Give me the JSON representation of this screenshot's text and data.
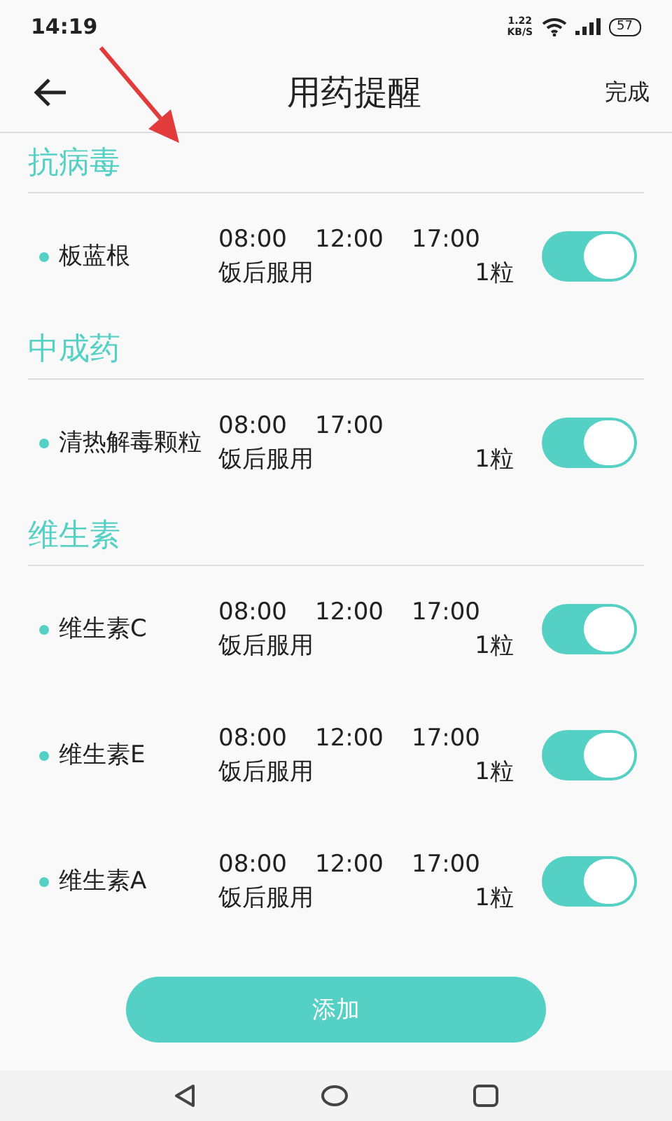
{
  "status_bar": {
    "time": "14:19",
    "speed": "1.22",
    "speed_unit": "KB/S",
    "battery": "57"
  },
  "header": {
    "title": "用药提醒",
    "action": "完成"
  },
  "groups": [
    {
      "title": "抗病毒",
      "items": [
        {
          "name": "板蓝根",
          "times": [
            "08:00",
            "12:00",
            "17:00"
          ],
          "note": "饭后服用",
          "dose": "1粒",
          "on": true
        }
      ]
    },
    {
      "title": "中成药",
      "items": [
        {
          "name": "清热解毒颗粒",
          "times": [
            "08:00",
            "17:00"
          ],
          "note": "饭后服用",
          "dose": "1粒",
          "on": true
        }
      ]
    },
    {
      "title": "维生素",
      "items": [
        {
          "name": "维生素C",
          "times": [
            "08:00",
            "12:00",
            "17:00"
          ],
          "note": "饭后服用",
          "dose": "1粒",
          "on": true
        },
        {
          "name": "维生素E",
          "times": [
            "08:00",
            "12:00",
            "17:00"
          ],
          "note": "饭后服用",
          "dose": "1粒",
          "on": true
        },
        {
          "name": "维生素A",
          "times": [
            "08:00",
            "12:00",
            "17:00"
          ],
          "note": "饭后服用",
          "dose": "1粒",
          "on": true
        }
      ]
    }
  ],
  "add_button": "添加"
}
